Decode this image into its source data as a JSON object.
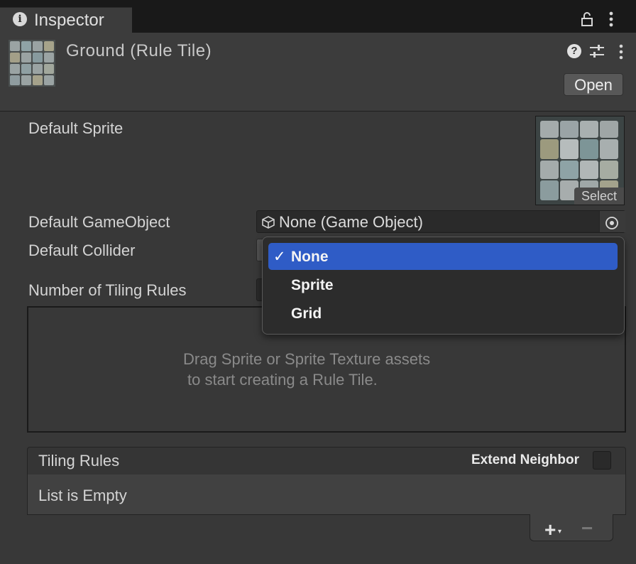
{
  "tab": {
    "label": "Inspector",
    "info_icon": "info-icon"
  },
  "header": {
    "title": "Ground (Rule Tile)",
    "open_label": "Open",
    "help_glyph": "?"
  },
  "fields": {
    "default_sprite_label": "Default Sprite",
    "select_label": "Select",
    "default_gameobject_label": "Default GameObject",
    "default_gameobject_value": "None (Game Object)",
    "default_collider_label": "Default Collider",
    "number_of_rules_label": "Number of Tiling Rules"
  },
  "drop_area": {
    "line1": "Drag Sprite or Sprite Texture assets",
    "line2": "to start creating a Rule Tile."
  },
  "rules": {
    "title": "Tiling Rules",
    "extend_neighbor_label": "Extend Neighbor",
    "empty_text": "List is Empty",
    "add_glyph": "+",
    "remove_glyph": "−"
  },
  "dropdown": {
    "selected": "None",
    "options": [
      "None",
      "Sprite",
      "Grid"
    ],
    "check_glyph": "✓"
  },
  "colors": {
    "selection": "#2f5cc6",
    "background": "#383838",
    "tab_bar": "#191919"
  }
}
